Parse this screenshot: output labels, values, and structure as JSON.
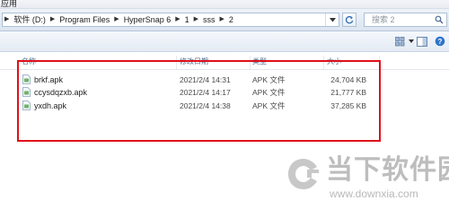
{
  "menu": {
    "app_label": "应用"
  },
  "address": {
    "crumbs": [
      "软件 (D:)",
      "Program Files",
      "HyperSnap 6",
      "1",
      "sss",
      "2"
    ]
  },
  "search": {
    "placeholder": "搜索 2"
  },
  "columns": {
    "name": "名称",
    "modified": "修改日期",
    "type": "类型",
    "size": "大小"
  },
  "files": [
    {
      "name": "brkf.apk",
      "modified": "2021/2/4 14:31",
      "type": "APK 文件",
      "size": "24,704 KB"
    },
    {
      "name": "ccysdqzxb.apk",
      "modified": "2021/2/4 14:17",
      "type": "APK 文件",
      "size": "21,777 KB"
    },
    {
      "name": "yxdh.apk",
      "modified": "2021/2/4 14:38",
      "type": "APK 文件",
      "size": "37,285 KB"
    }
  ],
  "watermark": {
    "title": "当下软件园",
    "url": "www.downxia.com"
  },
  "colors": {
    "highlight": "#e0101a",
    "header_text": "#4f6b8a"
  }
}
